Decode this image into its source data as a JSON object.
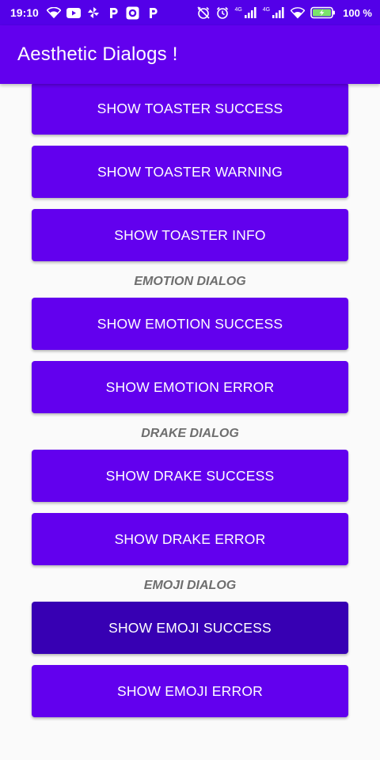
{
  "status_bar": {
    "time": "19:10",
    "network_left_tag": "4G",
    "network_right_tag": "4G",
    "battery_percent": "100 %",
    "left_icons": [
      "wifi-icon",
      "youtube-icon",
      "pinwheel-icon",
      "p-app-icon",
      "camera-circle-icon",
      "p-app-icon"
    ],
    "right_icons": [
      "alarm-off-icon",
      "alarm-icon",
      "signal-icon",
      "signal-icon",
      "wifi-icon",
      "battery-charging-icon"
    ]
  },
  "app_bar": {
    "title": "Aesthetic Dialogs !"
  },
  "colors": {
    "primary": "#6200ee",
    "primary_dark": "#3700b3",
    "status_bar": "#5300e8",
    "background": "#fafafa",
    "section_label": "#6e6e6e",
    "battery_fill": "#7be36a"
  },
  "toaster": {
    "buttons": [
      {
        "label": "SHOW TOASTER SUCCESS"
      },
      {
        "label": "SHOW TOASTER WARNING"
      },
      {
        "label": "SHOW TOASTER INFO"
      }
    ]
  },
  "emotion": {
    "section_label": "EMOTION DIALOG",
    "buttons": [
      {
        "label": "SHOW EMOTION SUCCESS"
      },
      {
        "label": "SHOW EMOTION ERROR"
      }
    ]
  },
  "drake": {
    "section_label": "DRAKE DIALOG",
    "buttons": [
      {
        "label": "SHOW DRAKE SUCCESS"
      },
      {
        "label": "SHOW DRAKE ERROR"
      }
    ]
  },
  "emoji": {
    "section_label": "EMOJI DIALOG",
    "buttons": [
      {
        "label": "SHOW EMOJI SUCCESS",
        "state": "pressed"
      },
      {
        "label": "SHOW EMOJI ERROR"
      }
    ]
  }
}
